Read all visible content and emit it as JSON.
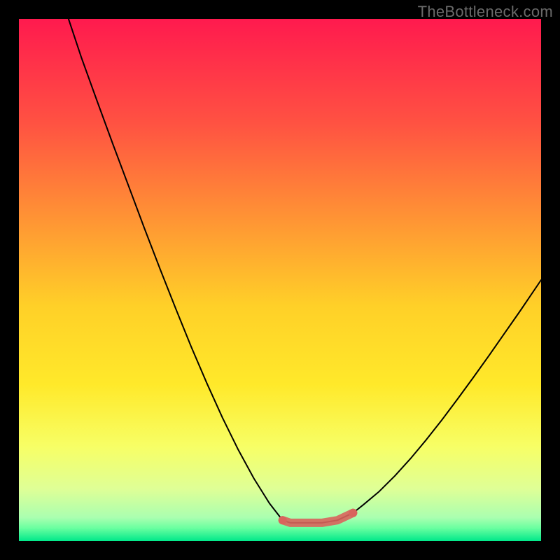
{
  "watermark": "TheBottleneck.com",
  "chart_data": {
    "type": "line",
    "title": "",
    "xlabel": "",
    "ylabel": "",
    "xlim": [
      0,
      100
    ],
    "ylim": [
      0,
      100
    ],
    "grid": false,
    "series": [
      {
        "name": "curve",
        "x_pct": [
          0.095,
          0.12,
          0.15,
          0.18,
          0.21,
          0.24,
          0.27,
          0.3,
          0.33,
          0.36,
          0.39,
          0.42,
          0.45,
          0.48,
          0.505,
          0.52,
          0.55,
          0.58,
          0.61,
          0.64,
          0.66,
          0.69,
          0.72,
          0.75,
          0.78,
          0.81,
          0.84,
          0.87,
          0.9,
          0.93,
          0.96,
          1.0
        ],
        "y_pct": [
          0.0,
          0.075,
          0.158,
          0.24,
          0.32,
          0.4,
          0.478,
          0.554,
          0.628,
          0.698,
          0.764,
          0.825,
          0.88,
          0.928,
          0.96,
          0.965,
          0.965,
          0.965,
          0.96,
          0.946,
          0.93,
          0.905,
          0.875,
          0.842,
          0.806,
          0.768,
          0.728,
          0.687,
          0.645,
          0.602,
          0.559,
          0.5
        ]
      },
      {
        "name": "bottom-marker",
        "x_pct": [
          0.505,
          0.52,
          0.55,
          0.58,
          0.61,
          0.64
        ],
        "y_pct": [
          0.96,
          0.965,
          0.965,
          0.965,
          0.96,
          0.946
        ]
      }
    ],
    "gradient_stops": [
      {
        "offset": 0.0,
        "color": "#ff1a4e"
      },
      {
        "offset": 0.2,
        "color": "#ff5242"
      },
      {
        "offset": 0.4,
        "color": "#ff9a33"
      },
      {
        "offset": 0.55,
        "color": "#ffd028"
      },
      {
        "offset": 0.7,
        "color": "#ffe92a"
      },
      {
        "offset": 0.82,
        "color": "#f7ff66"
      },
      {
        "offset": 0.9,
        "color": "#dfff96"
      },
      {
        "offset": 0.955,
        "color": "#aaffb0"
      },
      {
        "offset": 0.975,
        "color": "#6affa0"
      },
      {
        "offset": 1.0,
        "color": "#00e88a"
      }
    ],
    "curve_color": "#000000",
    "marker_color": "#d9645c",
    "marker_width_px": 12
  }
}
